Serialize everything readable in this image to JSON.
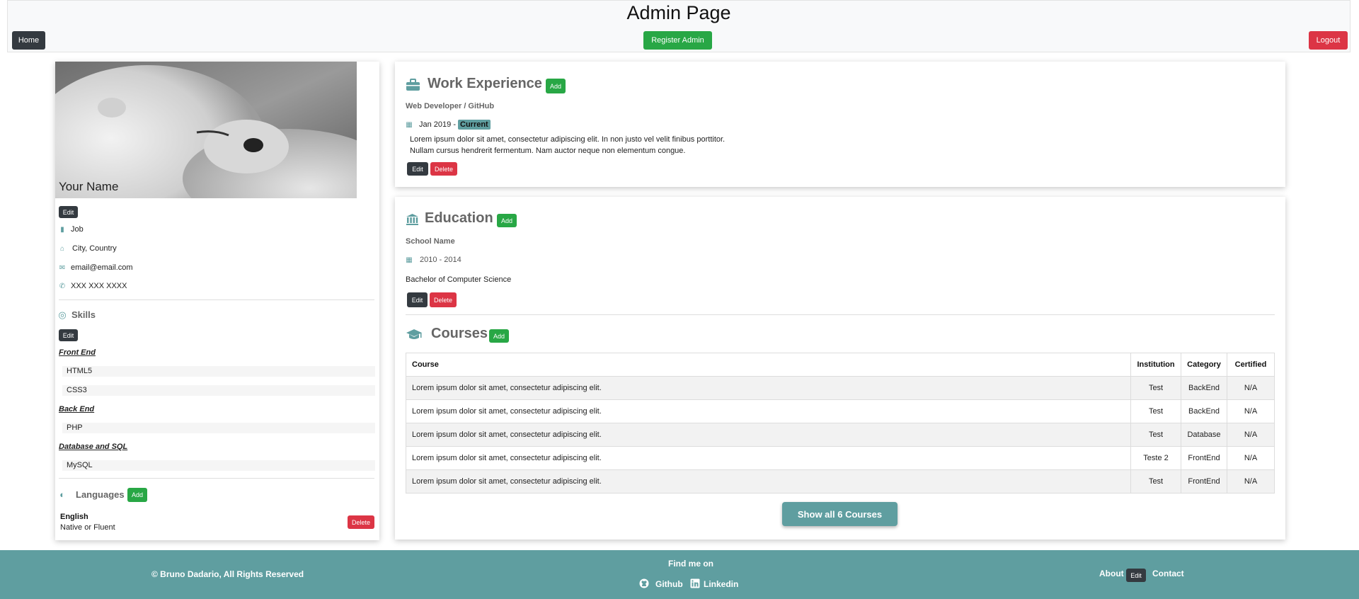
{
  "navbar": {
    "title": "Admin Page",
    "home_label": "Home",
    "register_label": "Register Admin",
    "logout_label": "Logout"
  },
  "profile": {
    "name": "Your Name",
    "edit_label": "Edit",
    "photo_icon": "polar-bear-photo",
    "job": "Job",
    "location": "City, Country",
    "email": "email@email.com",
    "phone": "XXX XXX XXXX"
  },
  "skills": {
    "title": "Skills",
    "edit_label": "Edit",
    "front_end": {
      "label": "Front End",
      "items": [
        "HTML5",
        "CSS3"
      ]
    },
    "back_end": {
      "label": "Back End",
      "items": [
        "PHP"
      ]
    },
    "database": {
      "label": "Database and SQL",
      "items": [
        "MySQL"
      ]
    }
  },
  "languages": {
    "title": "Languages",
    "add_label": "Add",
    "items": [
      {
        "name": "English",
        "level": "Native or Fluent",
        "delete_label": "Delete"
      }
    ]
  },
  "work": {
    "title": "Work Experience",
    "add_label": "Add",
    "entries": [
      {
        "position": "Web Developer / GitHub",
        "start": "Jan 2019 -",
        "current": "Current",
        "desc1": "Lorem ipsum dolor sit amet, consectetur adipiscing elit. In non justo vel velit finibus porttitor.",
        "desc2": "Nullam cursus hendrerit fermentum. Nam auctor neque non elementum congue.",
        "edit_label": "Edit",
        "delete_label": "Delete"
      }
    ]
  },
  "education": {
    "title": "Education",
    "add_label": "Add",
    "entries": [
      {
        "school": "School Name",
        "dates": "2010 - 2014",
        "degree": "Bachelor of Computer Science",
        "edit_label": "Edit",
        "delete_label": "Delete"
      }
    ]
  },
  "courses": {
    "title": "Courses",
    "add_label": "Add",
    "headers": [
      "Course",
      "Institution",
      "Category",
      "Certified"
    ],
    "rows": [
      [
        "Lorem ipsum dolor sit amet, consectetur adipiscing elit.",
        "Test",
        "BackEnd",
        "N/A"
      ],
      [
        "Lorem ipsum dolor sit amet, consectetur adipiscing elit.",
        "Test",
        "BackEnd",
        "N/A"
      ],
      [
        "Lorem ipsum dolor sit amet, consectetur adipiscing elit.",
        "Test",
        "Database",
        "N/A"
      ],
      [
        "Lorem ipsum dolor sit amet, consectetur adipiscing elit.",
        "Teste 2",
        "FrontEnd",
        "N/A"
      ],
      [
        "Lorem ipsum dolor sit amet, consectetur adipiscing elit.",
        "Test",
        "FrontEnd",
        "N/A"
      ]
    ],
    "show_all_label": "Show all 6 Courses"
  },
  "footer": {
    "copyright": "© Bruno Dadario, All Rights Reserved",
    "find_me": "Find me on",
    "github": "Github",
    "linkedin": "Linkedin",
    "about": "About",
    "edit_label": "Edit",
    "contact": "Contact"
  },
  "colors": {
    "accent": "#5f9ea0",
    "green": "#28a745",
    "red": "#dc3545",
    "dark": "#343a40"
  }
}
